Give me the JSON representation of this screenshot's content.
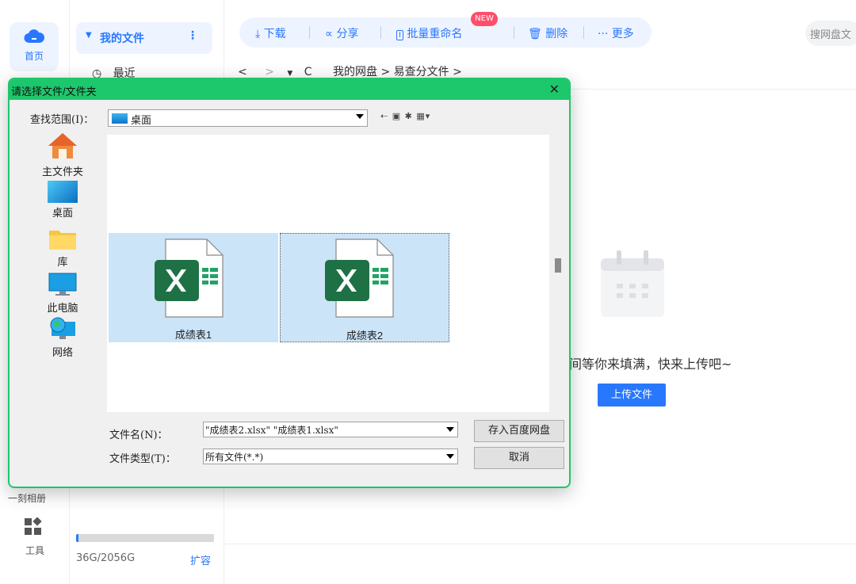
{
  "rail": {
    "home_label": "首页",
    "album_label": "一刻相册",
    "tools_label": "工具"
  },
  "sidebar": {
    "my_files": "我的文件",
    "recent": "最近",
    "storage_text": "36G/2056G",
    "storage_fraction": 0.0175,
    "expand": "扩容"
  },
  "toolbar": {
    "download": "下载",
    "share": "分享",
    "batch_rename": "批量重命名",
    "new_badge": "NEW",
    "delete": "删除",
    "more": "更多",
    "search_placeholder": "搜网盘文"
  },
  "breadcrumb": {
    "path": [
      "我的网盘",
      "易查分文件"
    ]
  },
  "empty_state": {
    "text": "间等你来填满，快来上传吧~",
    "upload_button": "上传文件"
  },
  "dialog": {
    "title": "请选择文件/文件夹",
    "look_in_label": "查找范围(I)：",
    "look_in_value": "桌面",
    "places": [
      "主文件夹",
      "桌面",
      "库",
      "此电脑",
      "网络"
    ],
    "files": [
      "成绩表1",
      "成绩表2"
    ],
    "file_name_label": "文件名(N)：",
    "file_name_value": "\"成绩表2.xlsx\" \"成绩表1.xlsx\"",
    "file_type_label": "文件类型(T)：",
    "file_type_value": "所有文件(*.*)",
    "save_button": "存入百度网盘",
    "cancel_button": "取消"
  },
  "colors": {
    "accent": "#2878ff",
    "dialog_border": "#1dc76c",
    "selection": "#cce4f7",
    "excel_green": "#1e7145"
  }
}
